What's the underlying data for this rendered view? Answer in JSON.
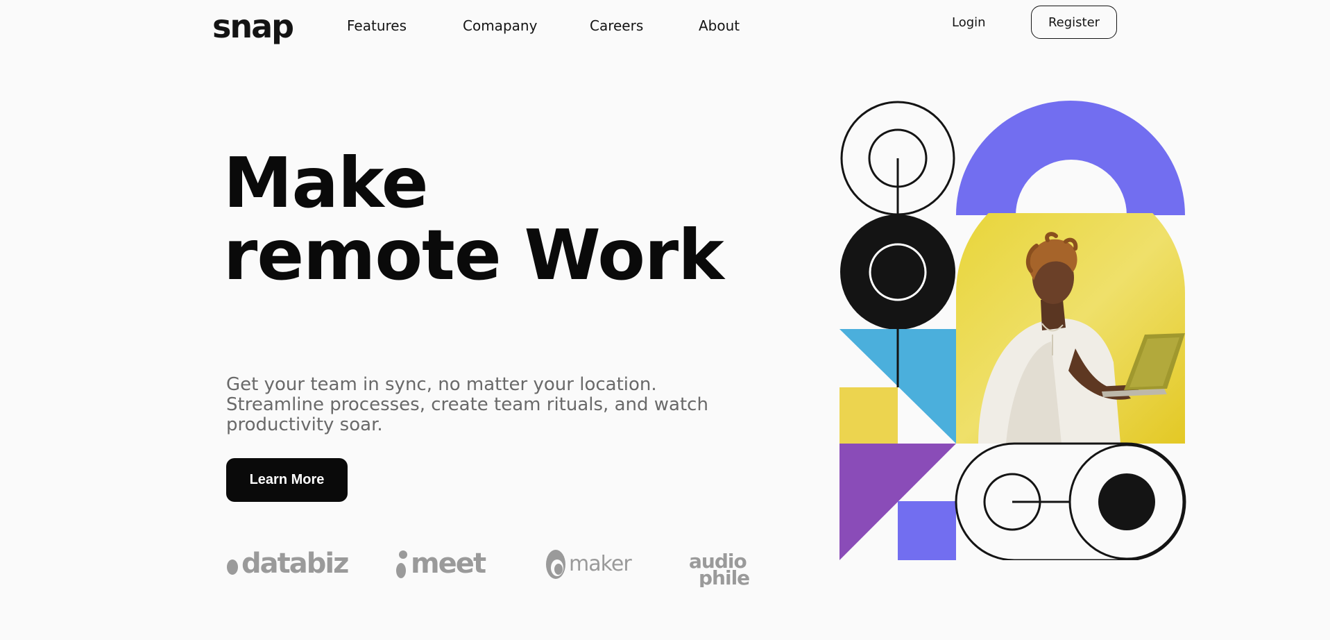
{
  "header": {
    "logo": "snap",
    "nav": [
      "Features",
      "Comapany",
      "Careers",
      "About"
    ],
    "login": "Login",
    "register": "Register"
  },
  "hero": {
    "title_line1": "Make",
    "title_line2": "remote Work",
    "subtitle": "Get your team in sync, no matter your location. Streamline processes, create team rituals, and watch productivity soar.",
    "cta": "Learn More"
  },
  "clients": [
    "databiz",
    "meet",
    "maker",
    "audiophile"
  ],
  "colors": {
    "text": "#141414",
    "muted": "#696969",
    "logo_gray": "#9a9a9a",
    "purple_blue": "#726ef0",
    "yellow": "#e9d339",
    "light_blue": "#4bafdc",
    "violet": "#8a4cb8",
    "pale_yellow": "#ecd44f"
  }
}
